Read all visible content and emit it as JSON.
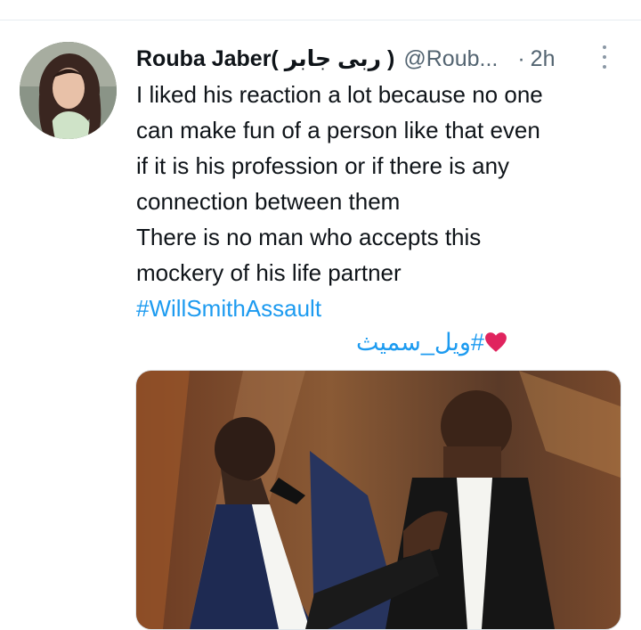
{
  "tweet": {
    "author_name": "Rouba Jaber( ربى جابر )",
    "handle": "@Roub...",
    "separator": "·",
    "time": "2h",
    "text_lines": [
      "I liked his reaction a lot because no one",
      "can make fun of a person like that even",
      "if it is his profession or if there is any",
      "connection between them",
      "There is no man who accepts this",
      "mockery of his life partner"
    ],
    "hashtag": "#WillSmithAssault",
    "arabic_hashtag": "#ويل_سميث",
    "heart_icon": "red-heart-icon",
    "more_icon": "more-vertical-icon",
    "colors": {
      "link": "#1d9bf0",
      "text": "#0f1419",
      "secondary": "#536471",
      "heart": "#e0245e"
    }
  }
}
